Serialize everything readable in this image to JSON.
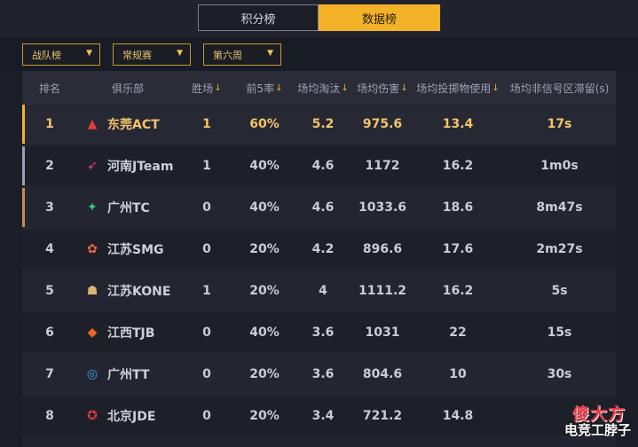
{
  "tabs": [
    {
      "label": "积分榜",
      "active": false
    },
    {
      "label": "数据榜",
      "active": true
    }
  ],
  "filters": [
    {
      "label": "战队榜",
      "arrow": "▼"
    },
    {
      "label": "常规赛",
      "arrow": "▼"
    },
    {
      "label": "第六周",
      "arrow": "▼"
    }
  ],
  "columns": [
    {
      "label": "排名",
      "sortable": false
    },
    {
      "label": "俱乐部",
      "sortable": false
    },
    {
      "label": "胜场",
      "sortable": true
    },
    {
      "label": "前5率",
      "sortable": true
    },
    {
      "label": "场均淘汰",
      "sortable": true
    },
    {
      "label": "场均伤害",
      "sortable": true
    },
    {
      "label": "场均投掷物使用",
      "sortable": true
    },
    {
      "label": "场均非信号区滞留(s)",
      "sortable": false
    }
  ],
  "sort_glyph": "↓",
  "rows": [
    {
      "rank": "1",
      "club": "东莞ACT",
      "logo": "act-logo-icon",
      "wins": "1",
      "top5": "60%",
      "elims": "5.2",
      "damage": "975.6",
      "throwables": "13.4",
      "outside": "17s",
      "accent": "#f3b228"
    },
    {
      "rank": "2",
      "club": "河南JTeam",
      "logo": "jteam-logo-icon",
      "wins": "1",
      "top5": "40%",
      "elims": "4.6",
      "damage": "1172",
      "throwables": "16.2",
      "outside": "1m0s",
      "accent": "#9aa0b0"
    },
    {
      "rank": "3",
      "club": "广州TC",
      "logo": "tc-logo-icon",
      "wins": "0",
      "top5": "40%",
      "elims": "4.6",
      "damage": "1033.6",
      "throwables": "18.6",
      "outside": "8m47s",
      "accent": "#c98b4a"
    },
    {
      "rank": "4",
      "club": "江苏SMG",
      "logo": "smg-logo-icon",
      "wins": "0",
      "top5": "20%",
      "elims": "4.2",
      "damage": "896.6",
      "throwables": "17.6",
      "outside": "2m27s",
      "accent": ""
    },
    {
      "rank": "5",
      "club": "江苏KONE",
      "logo": "kone-logo-icon",
      "wins": "1",
      "top5": "20%",
      "elims": "4",
      "damage": "1111.2",
      "throwables": "16.2",
      "outside": "5s",
      "accent": ""
    },
    {
      "rank": "6",
      "club": "江西TJB",
      "logo": "tjb-logo-icon",
      "wins": "0",
      "top5": "40%",
      "elims": "3.6",
      "damage": "1031",
      "throwables": "22",
      "outside": "15s",
      "accent": ""
    },
    {
      "rank": "7",
      "club": "广州TT",
      "logo": "tt-logo-icon",
      "wins": "0",
      "top5": "20%",
      "elims": "3.6",
      "damage": "804.6",
      "throwables": "10",
      "outside": "30s",
      "accent": ""
    },
    {
      "rank": "8",
      "club": "北京JDE",
      "logo": "jde-logo-icon",
      "wins": "0",
      "top5": "20%",
      "elims": "3.4",
      "damage": "721.2",
      "throwables": "14.8",
      "outside": "",
      "accent": ""
    }
  ],
  "watermark": {
    "line1": "傻大方",
    "line2": "电竞工脖子"
  }
}
